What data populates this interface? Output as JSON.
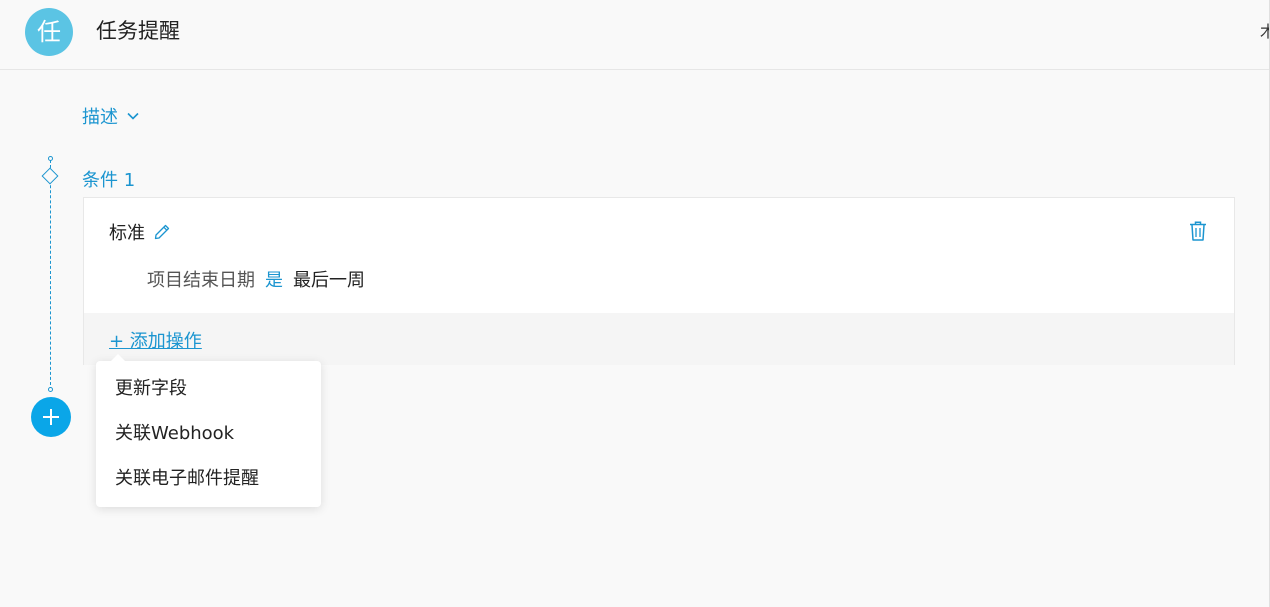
{
  "header": {
    "avatar_letter": "任",
    "title": "任务提醒",
    "edge_glyph": "木"
  },
  "description": {
    "label": "描述"
  },
  "condition": {
    "label": "条件 1",
    "card": {
      "title": "标准",
      "rule": {
        "field": "项目结束日期",
        "operator": "是",
        "value": "最后一周"
      },
      "add_action_label": "+ 添加操作"
    }
  },
  "action_menu": {
    "items": [
      {
        "label": "更新字段"
      },
      {
        "label": "关联Webhook"
      },
      {
        "label": "关联电子邮件提醒"
      }
    ]
  },
  "colors": {
    "accent": "#1b95d0",
    "avatar_bg": "#5bc4e4",
    "plus_button": "#0aa6e8"
  },
  "icons": [
    "chevron-down-icon",
    "pencil-icon",
    "trash-icon",
    "plus-icon",
    "diamond-icon"
  ]
}
